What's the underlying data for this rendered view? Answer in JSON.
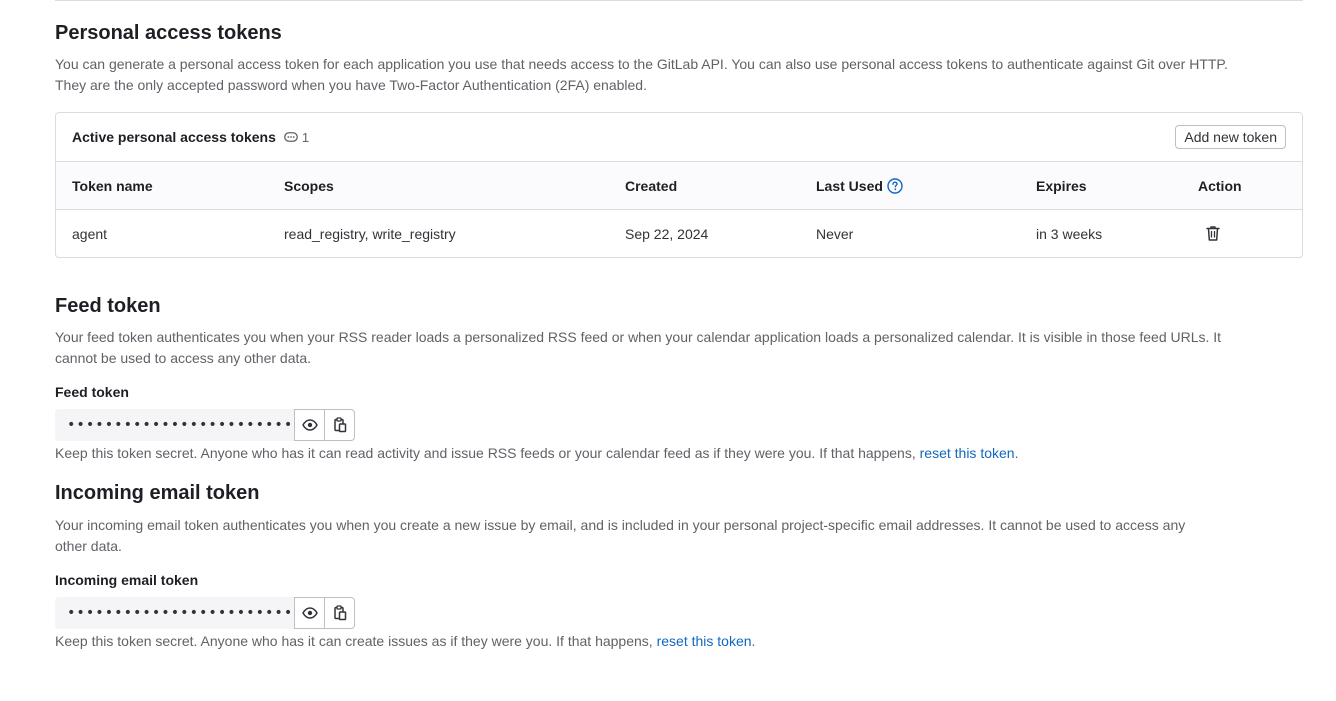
{
  "pat": {
    "title": "Personal access tokens",
    "description_line1": "You can generate a personal access token for each application you use that needs access to the GitLab API. You can also use personal access tokens to authenticate against Git over HTTP.",
    "description_line2": "They are the only accepted password when you have Two-Factor Authentication (2FA) enabled.",
    "card_title": "Active personal access tokens",
    "count": "1",
    "add_button": "Add new token",
    "columns": {
      "name": "Token name",
      "scopes": "Scopes",
      "created": "Created",
      "last_used": "Last Used",
      "expires": "Expires",
      "action": "Action"
    },
    "rows": [
      {
        "name": "agent",
        "scopes": "read_registry, write_registry",
        "created": "Sep 22, 2024",
        "last_used": "Never",
        "expires": "in 3 weeks"
      }
    ]
  },
  "feed": {
    "title": "Feed token",
    "description_line1": "Your feed token authenticates you when your RSS reader loads a personalized RSS feed or when your calendar application loads a personalized calendar. It is visible in those feed URLs. It",
    "description_line2": "cannot be used to access any other data.",
    "label": "Feed token",
    "value": "••••••••••••••••••••••••••••",
    "help_prefix": "Keep this token secret. Anyone who has it can read activity and issue RSS feeds or your calendar feed as if they were you. If that happens,",
    "help_link": "reset this token",
    "help_suffix": "."
  },
  "incoming": {
    "title": "Incoming email token",
    "description_line1": "Your incoming email token authenticates you when you create a new issue by email, and is included in your personal project-specific email addresses. It cannot be used to access any",
    "description_line2": "other data.",
    "label": "Incoming email token",
    "value": "••••••••••••••••••••••••••••",
    "help_prefix": "Keep this token secret. Anyone who has it can create issues as if they were you. If that happens,",
    "help_link": "reset this token",
    "help_suffix": "."
  },
  "icons": {
    "count": "token-icon",
    "help": "question-circle-icon",
    "delete": "trash-icon",
    "reveal": "eye-icon",
    "copy": "copy-to-clipboard-icon"
  },
  "colors": {
    "link": "#1068bf",
    "border": "#dcdcde",
    "text_muted": "#626168"
  }
}
